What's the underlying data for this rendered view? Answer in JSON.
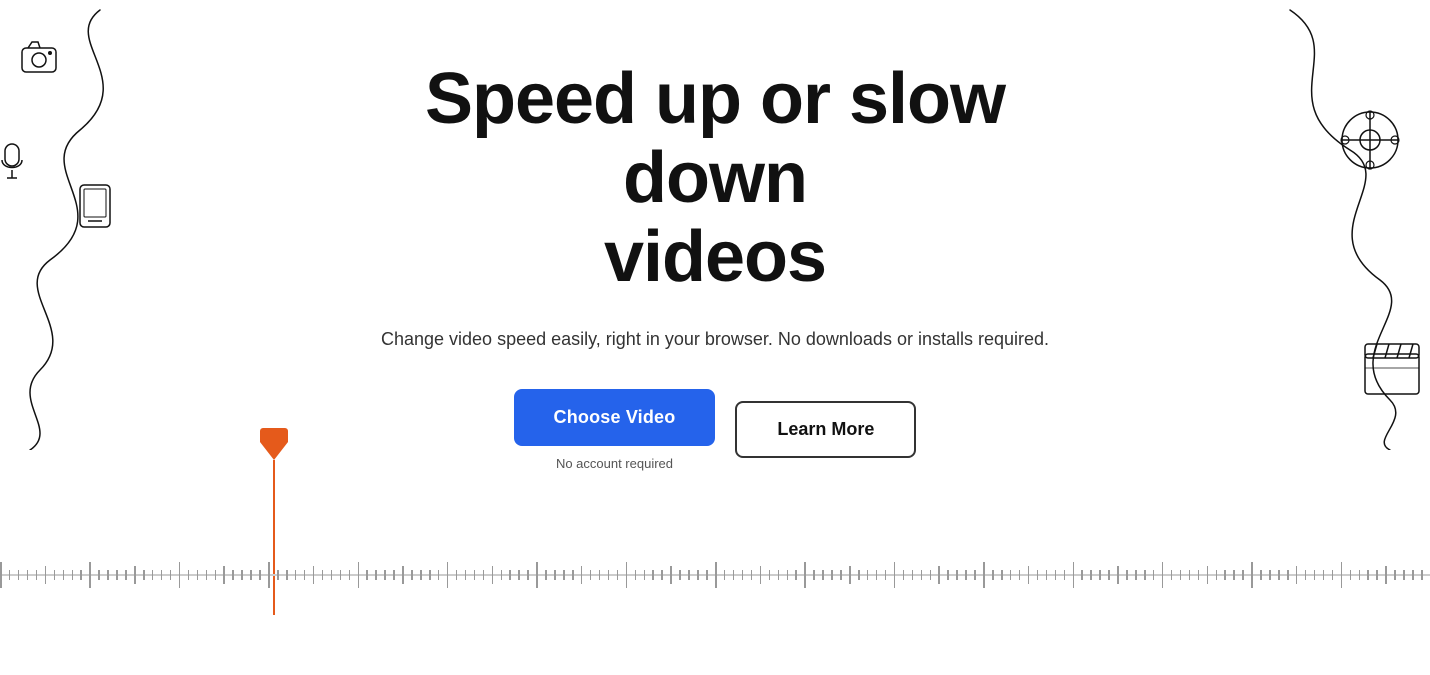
{
  "hero": {
    "title_line1": "Speed up or slow down",
    "title_line2": "videos",
    "subtitle": "Change video speed easily, right in your browser. No downloads or installs required.",
    "cta_primary": "Choose Video",
    "cta_secondary": "Learn More",
    "no_account_label": "No account required"
  },
  "colors": {
    "primary_btn": "#2563eb",
    "playhead": "#e55a1b",
    "text_dark": "#111111",
    "text_muted": "#555555",
    "border": "#333333"
  },
  "timeline": {
    "tick_count": 140
  }
}
